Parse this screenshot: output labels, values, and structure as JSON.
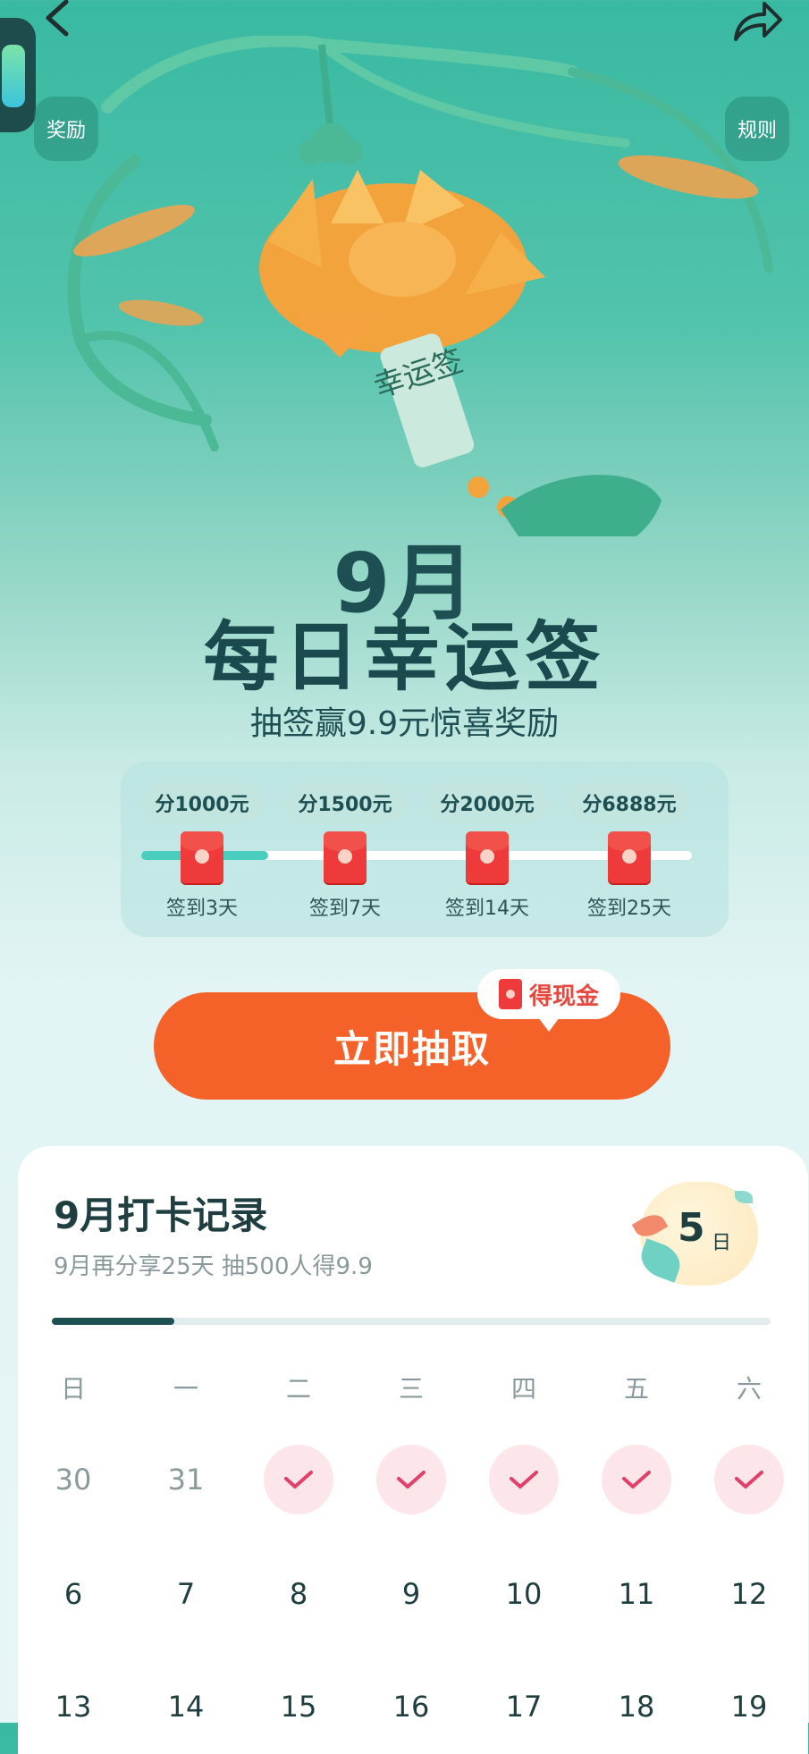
{
  "header": {
    "back_icon": "chevron-left-icon",
    "share_icon": "share-arrow-icon",
    "reward_label": "奖励",
    "rules_label": "规则"
  },
  "hero": {
    "tag_text": "幸运签",
    "month": "9月",
    "title": "每日幸运签",
    "subtitle": "抽签赢9.9元惊喜奖励"
  },
  "milestones": {
    "progress_fraction": 0.23,
    "items": [
      {
        "reward": "分1000元",
        "label": "签到3天"
      },
      {
        "reward": "分1500元",
        "label": "签到7天"
      },
      {
        "reward": "分2000元",
        "label": "签到14天"
      },
      {
        "reward": "分6888元",
        "label": "签到25天"
      }
    ]
  },
  "cta": {
    "label": "立即抽取",
    "bubble": "得现金"
  },
  "record": {
    "title": "9月打卡记录",
    "subtitle": "9月再分享25天 抽500人得9.9",
    "days": "5",
    "days_unit": "日",
    "progress_fraction": 0.17,
    "weekdays": [
      "日",
      "一",
      "二",
      "三",
      "四",
      "五",
      "六"
    ],
    "rows": [
      [
        {
          "day": "30",
          "state": "muted"
        },
        {
          "day": "31",
          "state": "muted"
        },
        {
          "day": "",
          "state": "checked"
        },
        {
          "day": "",
          "state": "checked"
        },
        {
          "day": "",
          "state": "checked"
        },
        {
          "day": "",
          "state": "checked"
        },
        {
          "day": "",
          "state": "checked"
        }
      ],
      [
        {
          "day": "6",
          "state": "normal"
        },
        {
          "day": "7",
          "state": "normal"
        },
        {
          "day": "8",
          "state": "normal"
        },
        {
          "day": "9",
          "state": "normal"
        },
        {
          "day": "10",
          "state": "normal"
        },
        {
          "day": "11",
          "state": "normal"
        },
        {
          "day": "12",
          "state": "normal"
        }
      ],
      [
        {
          "day": "13",
          "state": "normal"
        },
        {
          "day": "14",
          "state": "normal"
        },
        {
          "day": "15",
          "state": "normal"
        },
        {
          "day": "16",
          "state": "normal"
        },
        {
          "day": "17",
          "state": "normal"
        },
        {
          "day": "18",
          "state": "normal"
        },
        {
          "day": "19",
          "state": "normal"
        }
      ]
    ]
  },
  "colors": {
    "accent": "#f4622a",
    "dark_teal": "#1d4f53",
    "check_bg": "#fde6ea",
    "check": "#e0406a"
  }
}
